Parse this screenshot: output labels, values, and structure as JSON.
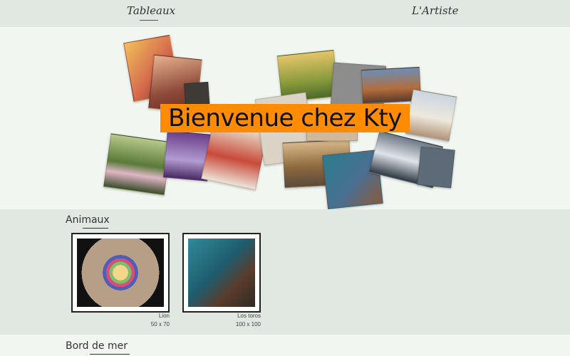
{
  "nav": {
    "tableaux": "Tableaux",
    "artiste": "L'Artiste"
  },
  "hero": {
    "title": "Bienvenue chez Kty"
  },
  "sections": [
    {
      "title": "Animaux",
      "items": [
        {
          "name": "Lion",
          "size": "50 x 70"
        },
        {
          "name": "Los toros",
          "size": "100 x 100"
        }
      ]
    },
    {
      "title": "Bord de mer"
    }
  ],
  "colors": {
    "banner": "#ff8c00",
    "nav_bg": "#e1e7e1",
    "hero_bg": "#f2f6f1"
  }
}
